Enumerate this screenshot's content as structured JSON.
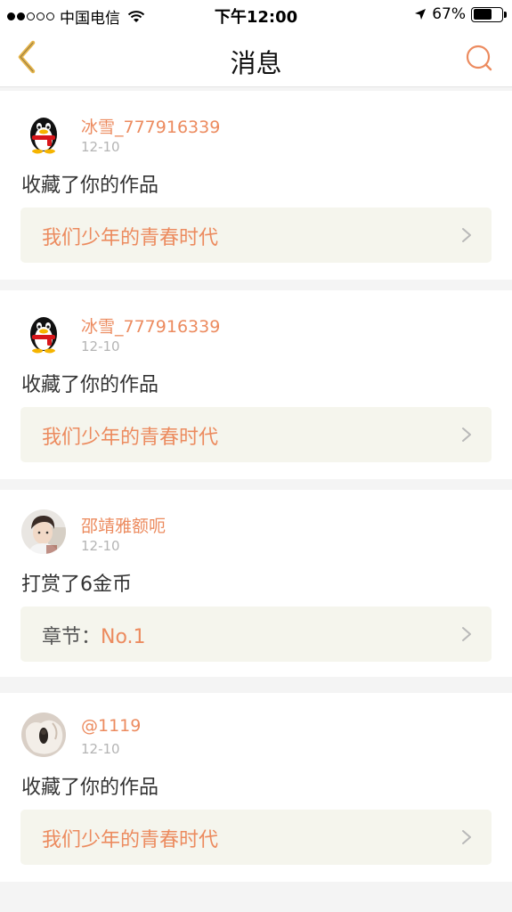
{
  "status_bar": {
    "carrier": "中国电信",
    "time": "下午12:00",
    "battery": "67%",
    "battery_level": 0.67
  },
  "nav": {
    "title": "消息",
    "back_icon": "chevron-left-icon",
    "search_icon": "search-icon"
  },
  "colors": {
    "accent": "#ec8b5f",
    "back_arrow": "#e6b54a",
    "card_bg": "#ffffff",
    "box_bg": "#f5f5ed",
    "page_bg": "#f4f4f4"
  },
  "messages": [
    {
      "avatar": "qq-penguin-avatar",
      "username": "冰雪_777916339",
      "date": "12-10",
      "action": "收藏了你的作品",
      "link_label": "",
      "link_text": "我们少年的青春时代"
    },
    {
      "avatar": "qq-penguin-avatar",
      "username": "冰雪_777916339",
      "date": "12-10",
      "action": "收藏了你的作品",
      "link_label": "",
      "link_text": "我们少年的青春时代"
    },
    {
      "avatar": "user-photo-avatar",
      "username": "邵靖雅额呃",
      "date": "12-10",
      "action": "打赏了6金币",
      "link_label": "章节：",
      "link_text": "No.1"
    },
    {
      "avatar": "user-photo-avatar",
      "username": "@1119",
      "date": "12-10",
      "action": "收藏了你的作品",
      "link_label": "",
      "link_text": "我们少年的青春时代"
    }
  ]
}
